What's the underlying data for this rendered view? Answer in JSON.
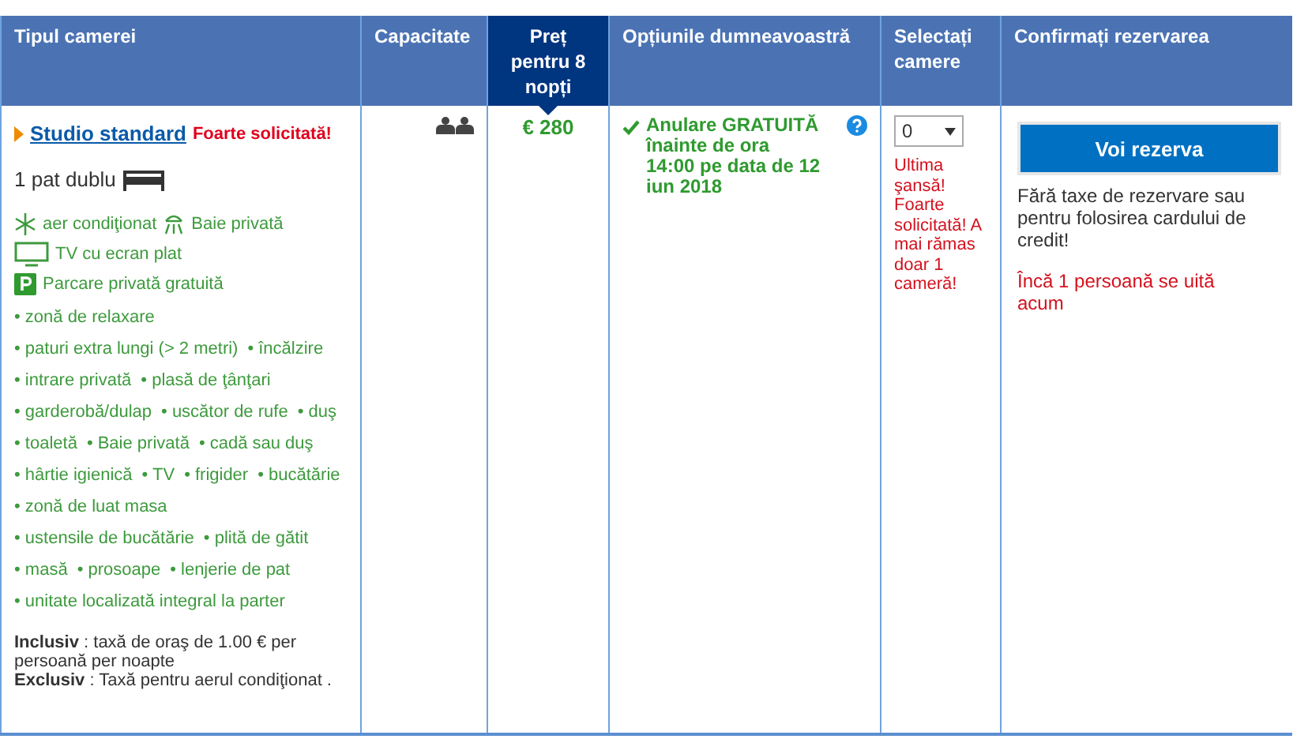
{
  "columns": [
    {
      "label": "Tipul camerei",
      "selected": false
    },
    {
      "label": "Capacitate",
      "selected": false
    },
    {
      "label": "Preț pentru 8 nopți",
      "selected": true
    },
    {
      "label": "Opțiunile dumneavoastră",
      "selected": false
    },
    {
      "label": "Selectați camere",
      "selected": false
    },
    {
      "label": "Confirmați rezervarea",
      "selected": false
    }
  ],
  "room": {
    "name": "Studio standard",
    "badge": "Foarte solicitată!",
    "bed": "1 pat dublu",
    "facility_rows": [
      [
        {
          "kind": "ac",
          "label": "aer condiţionat"
        },
        {
          "kind": "bath",
          "label": "Baie privată"
        }
      ],
      [
        {
          "kind": "tv",
          "label": "TV cu ecran plat"
        }
      ],
      [
        {
          "kind": "parking",
          "label": "Parcare privată gratuită"
        }
      ]
    ],
    "bullet_rows": [
      [
        "• zonă de relaxare"
      ],
      [
        "• paturi extra lungi (> 2 metri)",
        "• încălzire"
      ],
      [
        "• intrare privată",
        "• plasă de ţânţari"
      ],
      [
        "• garderobă/dulap",
        "• uscător de rufe",
        "• duş"
      ],
      [
        "• toaletă",
        "• Baie privată",
        "• cadă sau duş"
      ],
      [
        "• hârtie igienică",
        "• TV",
        "• frigider",
        "• bucătărie"
      ],
      [
        "• zonă de luat masa"
      ],
      [
        "• ustensile de bucătărie",
        "• plită de gătit"
      ],
      [
        "• masă",
        "• prosoape",
        "• lenjerie de pat"
      ],
      [
        "• unitate localizată integral la parter"
      ]
    ],
    "notes": [
      "**Inclusiv** : taxă de oraş de 1.00 € per persoană per noapte",
      "**Exclusiv** : Taxă pentru aerul condiţionat ."
    ]
  },
  "price": "€ 280",
  "option": {
    "text": "Anulare GRATUITĂ înainte de ora 14:00 pe data de 12 iun 2018"
  },
  "select": {
    "value": "0",
    "warning": "Ultima şansă! Foarte solicitată! A mai rămas doar 1 cameră!"
  },
  "confirm": {
    "button": "Voi rezerva",
    "info": "Fără taxe de rezervare sau pentru folosirea cardului de credit!",
    "watching": "Încă 1 persoană se uită acum"
  }
}
